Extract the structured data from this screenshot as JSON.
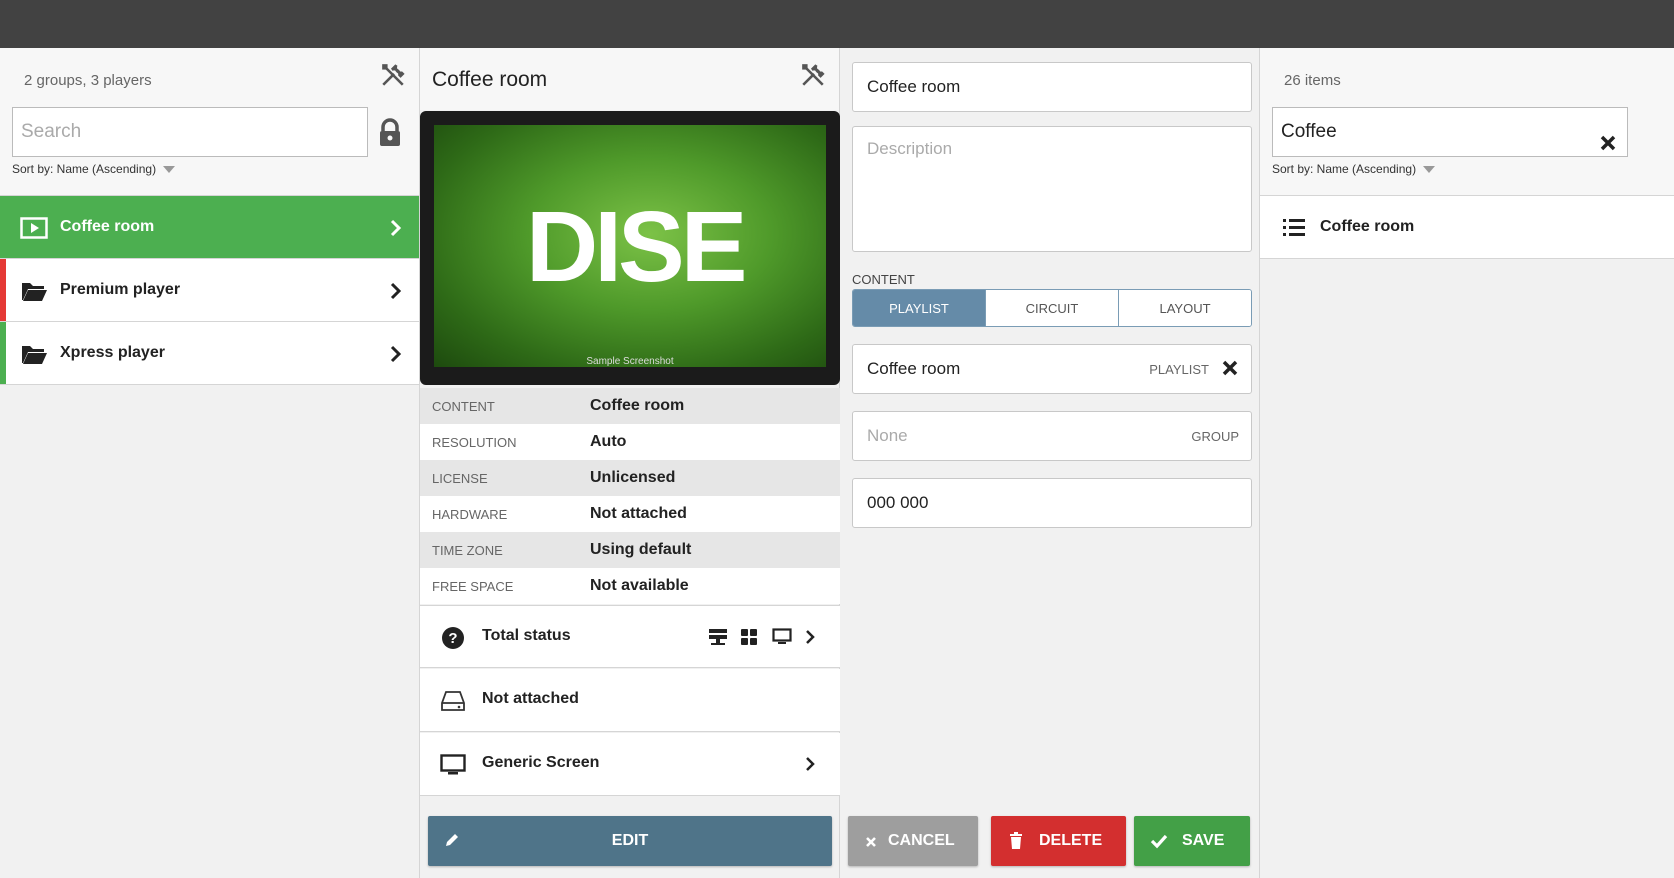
{
  "players_panel": {
    "count": "2 groups, 3 players",
    "search_placeholder": "Search",
    "sort": "Sort by: Name (Ascending)",
    "items": [
      {
        "label": "Coffee room",
        "color": "#4caf50"
      },
      {
        "label": "Premium player",
        "color": "#e53935"
      },
      {
        "label": "Xpress player",
        "color": "#4caf50"
      }
    ]
  },
  "details_panel": {
    "title": "Coffee room",
    "screen_logo": "DISΕ",
    "screen_caption": "Sample Screenshot",
    "properties": [
      {
        "key": "CONTENT",
        "value": "Coffee room"
      },
      {
        "key": "RESOLUTION",
        "value": "Auto"
      },
      {
        "key": "LICENSE",
        "value": "Unlicensed"
      },
      {
        "key": "HARDWARE",
        "value": "Not attached"
      },
      {
        "key": "TIME ZONE",
        "value": "Using default"
      },
      {
        "key": "FREE SPACE",
        "value": "Not available"
      }
    ],
    "total_status": "Total status",
    "hardware_status": "Not attached",
    "screen_type": "Generic Screen",
    "edit_label": "EDIT"
  },
  "edit_panel": {
    "name": "Coffee room",
    "description_placeholder": "Description",
    "content_label": "CONTENT",
    "content_tabs": [
      "PLAYLIST",
      "CIRCUIT",
      "LAYOUT"
    ],
    "content_value": "Coffee room",
    "content_tag": "PLAYLIST",
    "group_value": "None",
    "group_tag": "GROUP",
    "code": "000 000",
    "cancel_label": "CANCEL",
    "delete_label": "DELETE",
    "save_label": "SAVE"
  },
  "content_panel": {
    "count": "26 items",
    "search_value": "Coffee",
    "sort": "Sort by: Name (Ascending)",
    "items": [
      {
        "label": "Coffee room"
      }
    ]
  },
  "colors": {
    "active_green": "#4caf50",
    "edit_blue": "#4f7489",
    "cancel_grey": "#9e9e9e",
    "delete_red": "#d32f2f",
    "save_green": "#43a047",
    "tab_selected": "#658ba8"
  }
}
